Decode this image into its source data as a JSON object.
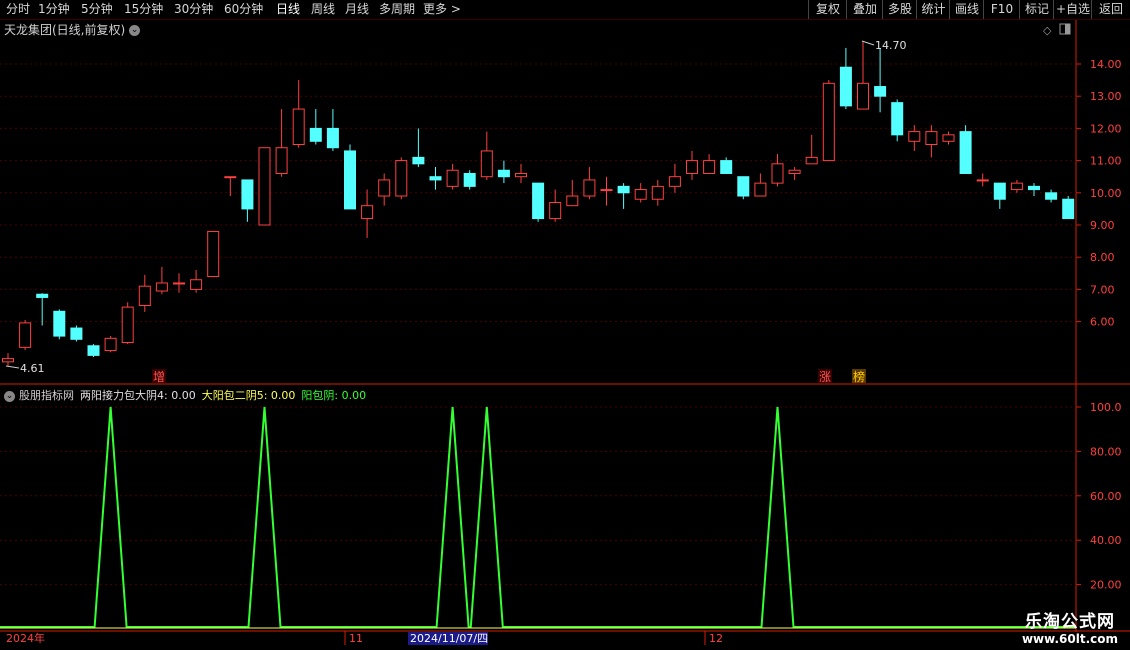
{
  "toolbar": {
    "periods": [
      "分时",
      "1分钟",
      "5分钟",
      "15分钟",
      "30分钟",
      "60分钟",
      "日线",
      "周线",
      "月线",
      "多周期",
      "更多 >"
    ],
    "active_period": "日线",
    "actions": [
      "复权",
      "叠加",
      "多股",
      "统计",
      "画线",
      "F10",
      "标记",
      "+自选",
      "返回"
    ]
  },
  "main_chart": {
    "title": "天龙集团(日线,前复权)",
    "high_label": "14.70",
    "low_label": "4.61",
    "price_ticks": [
      "14.00",
      "13.00",
      "12.00",
      "11.00",
      "10.00",
      "9.00",
      "8.00",
      "7.00",
      "6.00"
    ],
    "markers": [
      {
        "text": "增",
        "color": "#ff5555"
      },
      {
        "text": "涨",
        "color": "#ff5555"
      },
      {
        "text": "榜",
        "color": "#ffcc00"
      }
    ],
    "colors": {
      "up": "#ff4040",
      "down": "#54ffff",
      "grid": "#4a0000",
      "axis": "#d81e06"
    }
  },
  "indicator": {
    "name": "股朋指标网",
    "lines": [
      {
        "label": "两阳接力包大阴4: 0.00",
        "color": "#e0e0e0"
      },
      {
        "label": "大阳包二阴5: 0.00",
        "color": "#ffff55"
      },
      {
        "label": "阳包阴: 0.00",
        "color": "#33ff33"
      }
    ],
    "ticks": [
      "100.0",
      "80.00",
      "60.00",
      "40.00",
      "20.00"
    ]
  },
  "date_axis": {
    "labels": [
      "2024年",
      "11",
      "2024/11/07/四",
      "12"
    ]
  },
  "watermark": {
    "title": "乐淘公式网",
    "url": "www.60lt.com"
  },
  "chart_data": {
    "type": "candlestick",
    "title": "天龙集团(日线,前复权)",
    "ylim": [
      4.3,
      14.9
    ],
    "candles": [
      [
        4.75,
        4.85,
        5.02,
        4.61
      ],
      [
        5.2,
        5.96,
        6.05,
        5.12
      ],
      [
        6.85,
        6.75,
        6.88,
        5.88
      ],
      [
        6.32,
        5.55,
        6.38,
        5.45
      ],
      [
        5.8,
        5.45,
        5.88,
        5.38
      ],
      [
        5.25,
        4.95,
        5.3,
        4.9
      ],
      [
        5.1,
        5.48,
        5.55,
        5.05
      ],
      [
        5.35,
        6.45,
        6.6,
        5.3
      ],
      [
        6.5,
        7.1,
        7.45,
        6.3
      ],
      [
        6.95,
        7.2,
        7.7,
        6.85
      ],
      [
        7.2,
        7.2,
        7.5,
        6.9
      ],
      [
        7.0,
        7.3,
        7.6,
        6.9
      ],
      [
        7.4,
        8.8,
        8.8,
        7.4
      ],
      [
        10.5,
        10.5,
        10.5,
        9.9
      ],
      [
        10.4,
        9.5,
        10.4,
        9.1
      ],
      [
        9.0,
        11.4,
        11.4,
        9.0
      ],
      [
        10.6,
        11.4,
        12.6,
        10.5
      ],
      [
        11.5,
        12.6,
        13.5,
        11.4
      ],
      [
        12.0,
        11.6,
        12.6,
        11.5
      ],
      [
        12.0,
        11.4,
        12.6,
        11.3
      ],
      [
        11.3,
        9.5,
        11.5,
        9.5
      ],
      [
        9.2,
        9.6,
        10.1,
        8.6
      ],
      [
        9.9,
        10.4,
        10.6,
        9.6
      ],
      [
        9.9,
        11.0,
        11.1,
        9.8
      ],
      [
        11.1,
        10.9,
        12.0,
        10.8
      ],
      [
        10.5,
        10.4,
        10.8,
        10.1
      ],
      [
        10.2,
        10.7,
        10.9,
        10.1
      ],
      [
        10.6,
        10.2,
        10.7,
        10.1
      ],
      [
        10.5,
        11.3,
        11.9,
        10.4
      ],
      [
        10.7,
        10.5,
        11.0,
        10.3
      ],
      [
        10.5,
        10.6,
        10.9,
        10.3
      ],
      [
        10.3,
        9.2,
        10.3,
        9.1
      ],
      [
        9.2,
        9.7,
        10.1,
        9.1
      ],
      [
        9.6,
        9.9,
        10.4,
        9.6
      ],
      [
        9.9,
        10.4,
        10.8,
        9.8
      ],
      [
        10.1,
        10.1,
        10.5,
        9.6
      ],
      [
        10.2,
        10.0,
        10.3,
        9.5
      ],
      [
        9.8,
        10.1,
        10.3,
        9.7
      ],
      [
        9.8,
        10.2,
        10.4,
        9.6
      ],
      [
        10.2,
        10.5,
        10.9,
        10.0
      ],
      [
        10.6,
        11.0,
        11.3,
        10.4
      ],
      [
        10.6,
        11.0,
        11.2,
        10.6
      ],
      [
        11.0,
        10.6,
        11.1,
        10.6
      ],
      [
        10.5,
        9.9,
        10.5,
        9.8
      ],
      [
        9.9,
        10.3,
        10.6,
        9.9
      ],
      [
        10.3,
        10.9,
        11.2,
        10.2
      ],
      [
        10.6,
        10.7,
        10.8,
        10.4
      ],
      [
        10.9,
        11.1,
        11.8,
        10.9
      ],
      [
        11.0,
        13.4,
        13.5,
        11.0
      ],
      [
        13.9,
        12.7,
        14.5,
        12.6
      ],
      [
        12.6,
        13.4,
        14.7,
        12.6
      ],
      [
        13.3,
        13.0,
        14.5,
        12.5
      ],
      [
        12.8,
        11.8,
        12.9,
        11.6
      ],
      [
        11.6,
        11.9,
        12.1,
        11.3
      ],
      [
        11.5,
        11.9,
        12.1,
        11.1
      ],
      [
        11.6,
        11.8,
        11.9,
        11.5
      ],
      [
        11.9,
        10.6,
        12.1,
        10.6
      ],
      [
        10.4,
        10.4,
        10.6,
        10.2
      ],
      [
        10.3,
        9.8,
        10.3,
        9.5
      ],
      [
        10.1,
        10.3,
        10.4,
        10.0
      ],
      [
        10.2,
        10.1,
        10.3,
        9.9
      ],
      [
        10.0,
        9.8,
        10.1,
        9.7
      ],
      [
        9.8,
        9.2,
        9.9,
        9.2
      ]
    ]
  }
}
